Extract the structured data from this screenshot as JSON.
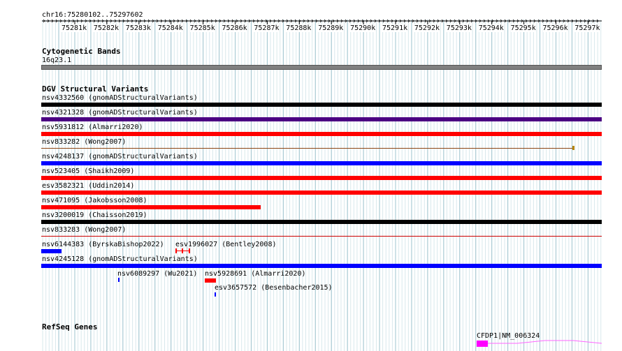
{
  "ruler": {
    "location": "chr16:75280102..75297602",
    "ticks": [
      "75281k",
      "75282k",
      "75283k",
      "75284k",
      "75285k",
      "75286k",
      "75287k",
      "75288k",
      "75289k",
      "75290k",
      "75291k",
      "75292k",
      "75293k",
      "75294k",
      "75295k",
      "75296k",
      "75297k"
    ]
  },
  "cytoband": {
    "title": "Cytogenetic Bands",
    "band_label": "16q23.1",
    "color": "#808080"
  },
  "dgv": {
    "title": "DGV Structural Variants",
    "items": [
      {
        "id": "nsv4332560",
        "source": "gnomADStructuralVariants",
        "label": "nsv4332560 (gnomADStructuralVariants)",
        "color": "#000000",
        "style": "bar"
      },
      {
        "id": "nsv4321328",
        "source": "gnomADStructuralVariants",
        "label": "nsv4321328 (gnomADStructuralVariants)",
        "color": "#4b0082",
        "style": "bar"
      },
      {
        "id": "nsv5931812",
        "source": "Almarri2020",
        "label": "nsv5931812 (Almarri2020)",
        "color": "#ff0000",
        "style": "bar"
      },
      {
        "id": "nsv833282",
        "source": "Wong2007",
        "label": "nsv833282 (Wong2007)",
        "color": "#8b4513",
        "style": "thin"
      },
      {
        "id": "nsv4248137",
        "source": "gnomADStructuralVariants",
        "label": "nsv4248137 (gnomADStructuralVariants)",
        "color": "#0000ff",
        "style": "bar"
      },
      {
        "id": "nsv523405",
        "source": "Shaikh2009",
        "label": "nsv523405 (Shaikh2009)",
        "color": "#ff0000",
        "style": "bar"
      },
      {
        "id": "esv3582321",
        "source": "Uddin2014",
        "label": "esv3582321 (Uddin2014)",
        "color": "#ff0000",
        "style": "bar"
      },
      {
        "id": "nsv471095",
        "source": "Jakobsson2008",
        "label": "nsv471095 (Jakobsson2008)",
        "color": "#ff0000",
        "style": "bar"
      },
      {
        "id": "nsv3200019",
        "source": "Chaisson2019",
        "label": "nsv3200019 (Chaisson2019)",
        "color": "#000000",
        "style": "bar"
      },
      {
        "id": "nsv833283",
        "source": "Wong2007",
        "label": "nsv833283 (Wong2007)",
        "color": "#cc0000",
        "style": "thin"
      },
      {
        "id": "nsv6144383",
        "source": "ByrskaBishop2022",
        "label": "nsv6144383 (ByrskaBishop2022)",
        "color": "#0000ff",
        "style": "bar"
      },
      {
        "id": "esv1996027",
        "source": "Bentley2008",
        "label": "esv1996027 (Bentley2008)",
        "color": "#ff0000",
        "style": "span"
      },
      {
        "id": "nsv4245128",
        "source": "gnomADStructuralVariants",
        "label": "nsv4245128 (gnomADStructuralVariants)",
        "color": "#0000ff",
        "style": "bar"
      },
      {
        "id": "nsv6089297",
        "source": "Wu2021",
        "label": "nsv6089297 (Wu2021)",
        "color": "#0000ff",
        "style": "tick"
      },
      {
        "id": "nsv5928691",
        "source": "Almarri2020",
        "label": "nsv5928691 (Almarri2020)",
        "color": "#ff0000",
        "style": "bar"
      },
      {
        "id": "esv3657572",
        "source": "Besenbacher2015",
        "label": "esv3657572 (Besenbacher2015)",
        "color": "#0000ff",
        "style": "tick"
      }
    ]
  },
  "refseq": {
    "title": "RefSeq Genes",
    "gene_label": "CFDP1|NM_006324",
    "exon_color": "#ff00ff",
    "intron_color": "#ff66ff"
  },
  "colors": {
    "grid_major": "#9fc4cf",
    "grid_minor": "#d8e8ec"
  }
}
